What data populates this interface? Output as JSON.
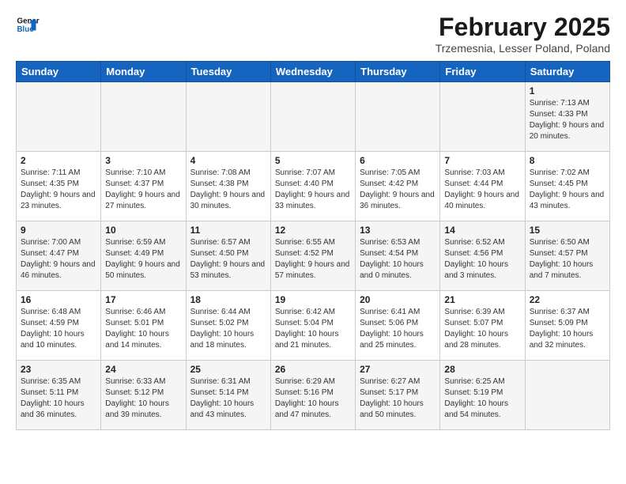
{
  "logo": {
    "line1": "General",
    "line2": "Blue"
  },
  "title": "February 2025",
  "subtitle": "Trzemesnia, Lesser Poland, Poland",
  "weekdays": [
    "Sunday",
    "Monday",
    "Tuesday",
    "Wednesday",
    "Thursday",
    "Friday",
    "Saturday"
  ],
  "weeks": [
    [
      {
        "day": "",
        "info": ""
      },
      {
        "day": "",
        "info": ""
      },
      {
        "day": "",
        "info": ""
      },
      {
        "day": "",
        "info": ""
      },
      {
        "day": "",
        "info": ""
      },
      {
        "day": "",
        "info": ""
      },
      {
        "day": "1",
        "info": "Sunrise: 7:13 AM\nSunset: 4:33 PM\nDaylight: 9 hours and 20 minutes."
      }
    ],
    [
      {
        "day": "2",
        "info": "Sunrise: 7:11 AM\nSunset: 4:35 PM\nDaylight: 9 hours and 23 minutes."
      },
      {
        "day": "3",
        "info": "Sunrise: 7:10 AM\nSunset: 4:37 PM\nDaylight: 9 hours and 27 minutes."
      },
      {
        "day": "4",
        "info": "Sunrise: 7:08 AM\nSunset: 4:38 PM\nDaylight: 9 hours and 30 minutes."
      },
      {
        "day": "5",
        "info": "Sunrise: 7:07 AM\nSunset: 4:40 PM\nDaylight: 9 hours and 33 minutes."
      },
      {
        "day": "6",
        "info": "Sunrise: 7:05 AM\nSunset: 4:42 PM\nDaylight: 9 hours and 36 minutes."
      },
      {
        "day": "7",
        "info": "Sunrise: 7:03 AM\nSunset: 4:44 PM\nDaylight: 9 hours and 40 minutes."
      },
      {
        "day": "8",
        "info": "Sunrise: 7:02 AM\nSunset: 4:45 PM\nDaylight: 9 hours and 43 minutes."
      }
    ],
    [
      {
        "day": "9",
        "info": "Sunrise: 7:00 AM\nSunset: 4:47 PM\nDaylight: 9 hours and 46 minutes."
      },
      {
        "day": "10",
        "info": "Sunrise: 6:59 AM\nSunset: 4:49 PM\nDaylight: 9 hours and 50 minutes."
      },
      {
        "day": "11",
        "info": "Sunrise: 6:57 AM\nSunset: 4:50 PM\nDaylight: 9 hours and 53 minutes."
      },
      {
        "day": "12",
        "info": "Sunrise: 6:55 AM\nSunset: 4:52 PM\nDaylight: 9 hours and 57 minutes."
      },
      {
        "day": "13",
        "info": "Sunrise: 6:53 AM\nSunset: 4:54 PM\nDaylight: 10 hours and 0 minutes."
      },
      {
        "day": "14",
        "info": "Sunrise: 6:52 AM\nSunset: 4:56 PM\nDaylight: 10 hours and 3 minutes."
      },
      {
        "day": "15",
        "info": "Sunrise: 6:50 AM\nSunset: 4:57 PM\nDaylight: 10 hours and 7 minutes."
      }
    ],
    [
      {
        "day": "16",
        "info": "Sunrise: 6:48 AM\nSunset: 4:59 PM\nDaylight: 10 hours and 10 minutes."
      },
      {
        "day": "17",
        "info": "Sunrise: 6:46 AM\nSunset: 5:01 PM\nDaylight: 10 hours and 14 minutes."
      },
      {
        "day": "18",
        "info": "Sunrise: 6:44 AM\nSunset: 5:02 PM\nDaylight: 10 hours and 18 minutes."
      },
      {
        "day": "19",
        "info": "Sunrise: 6:42 AM\nSunset: 5:04 PM\nDaylight: 10 hours and 21 minutes."
      },
      {
        "day": "20",
        "info": "Sunrise: 6:41 AM\nSunset: 5:06 PM\nDaylight: 10 hours and 25 minutes."
      },
      {
        "day": "21",
        "info": "Sunrise: 6:39 AM\nSunset: 5:07 PM\nDaylight: 10 hours and 28 minutes."
      },
      {
        "day": "22",
        "info": "Sunrise: 6:37 AM\nSunset: 5:09 PM\nDaylight: 10 hours and 32 minutes."
      }
    ],
    [
      {
        "day": "23",
        "info": "Sunrise: 6:35 AM\nSunset: 5:11 PM\nDaylight: 10 hours and 36 minutes."
      },
      {
        "day": "24",
        "info": "Sunrise: 6:33 AM\nSunset: 5:12 PM\nDaylight: 10 hours and 39 minutes."
      },
      {
        "day": "25",
        "info": "Sunrise: 6:31 AM\nSunset: 5:14 PM\nDaylight: 10 hours and 43 minutes."
      },
      {
        "day": "26",
        "info": "Sunrise: 6:29 AM\nSunset: 5:16 PM\nDaylight: 10 hours and 47 minutes."
      },
      {
        "day": "27",
        "info": "Sunrise: 6:27 AM\nSunset: 5:17 PM\nDaylight: 10 hours and 50 minutes."
      },
      {
        "day": "28",
        "info": "Sunrise: 6:25 AM\nSunset: 5:19 PM\nDaylight: 10 hours and 54 minutes."
      },
      {
        "day": "",
        "info": ""
      }
    ]
  ]
}
